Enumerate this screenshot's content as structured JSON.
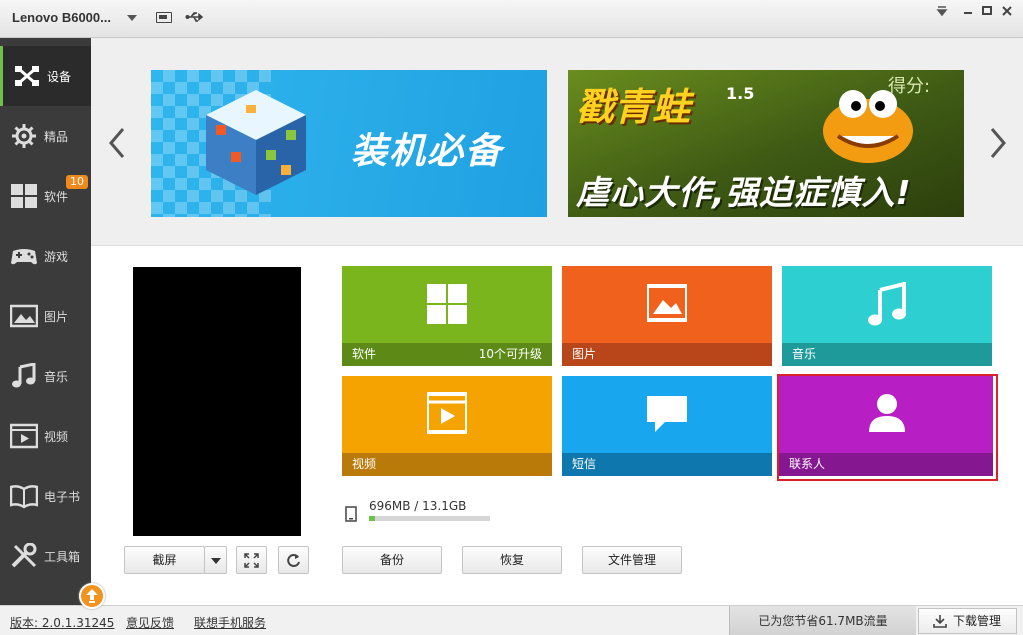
{
  "titlebar": {
    "device_name": "Lenovo B6000...",
    "icons": [
      "chevron-down-icon",
      "battery-icon",
      "usb-icon",
      "dropdown-triangle-icon",
      "minimize-icon",
      "maximize-icon",
      "close-icon"
    ]
  },
  "sidebar": {
    "items": [
      {
        "label": "设备",
        "icon": "device-icon",
        "active": true
      },
      {
        "label": "精品",
        "icon": "gear-icon"
      },
      {
        "label": "软件",
        "icon": "apps-icon",
        "badge": "10"
      },
      {
        "label": "游戏",
        "icon": "gamepad-icon"
      },
      {
        "label": "图片",
        "icon": "picture-icon"
      },
      {
        "label": "音乐",
        "icon": "music-icon"
      },
      {
        "label": "视频",
        "icon": "video-icon"
      },
      {
        "label": "电子书",
        "icon": "book-icon"
      },
      {
        "label": "工具箱",
        "icon": "tools-icon"
      }
    ]
  },
  "banners": [
    {
      "text": "装机必备"
    },
    {
      "title": "戳青蛙",
      "tagline": "虐心大作,强迫症慎入!",
      "score_label": "得分:",
      "number": "1.5"
    }
  ],
  "phone_controls": {
    "screenshot": "截屏"
  },
  "tiles": [
    {
      "label": "软件",
      "extra": "10个可升级",
      "color": "#7ab51d",
      "bar_color": "#5d8a16",
      "icon": "apps-icon"
    },
    {
      "label": "图片",
      "extra": "",
      "color": "#f0611e",
      "bar_color": "#b8461a",
      "icon": "picture-icon"
    },
    {
      "label": "音乐",
      "extra": "",
      "color": "#2dcfd0",
      "bar_color": "#1e9a9b",
      "icon": "music-icon"
    },
    {
      "label": "视频",
      "extra": "",
      "color": "#f5a300",
      "bar_color": "#b97a0a",
      "icon": "video-icon"
    },
    {
      "label": "短信",
      "extra": "",
      "color": "#18a6ee",
      "bar_color": "#0e77ad",
      "icon": "message-icon"
    },
    {
      "label": "联系人",
      "extra": "",
      "color": "#b71fc4",
      "bar_color": "#851790",
      "icon": "contact-icon"
    }
  ],
  "storage": {
    "text": "696MB / 13.1GB",
    "used_fraction": 0.052
  },
  "actions": {
    "backup": "备份",
    "restore": "恢复",
    "file_manager": "文件管理"
  },
  "statusbar": {
    "version": "版本: 2.0.1.31245",
    "feedback": "意见反馈",
    "service": "联想手机服务",
    "saved": "已为您节省61.7MB流量",
    "download": "下载管理"
  }
}
